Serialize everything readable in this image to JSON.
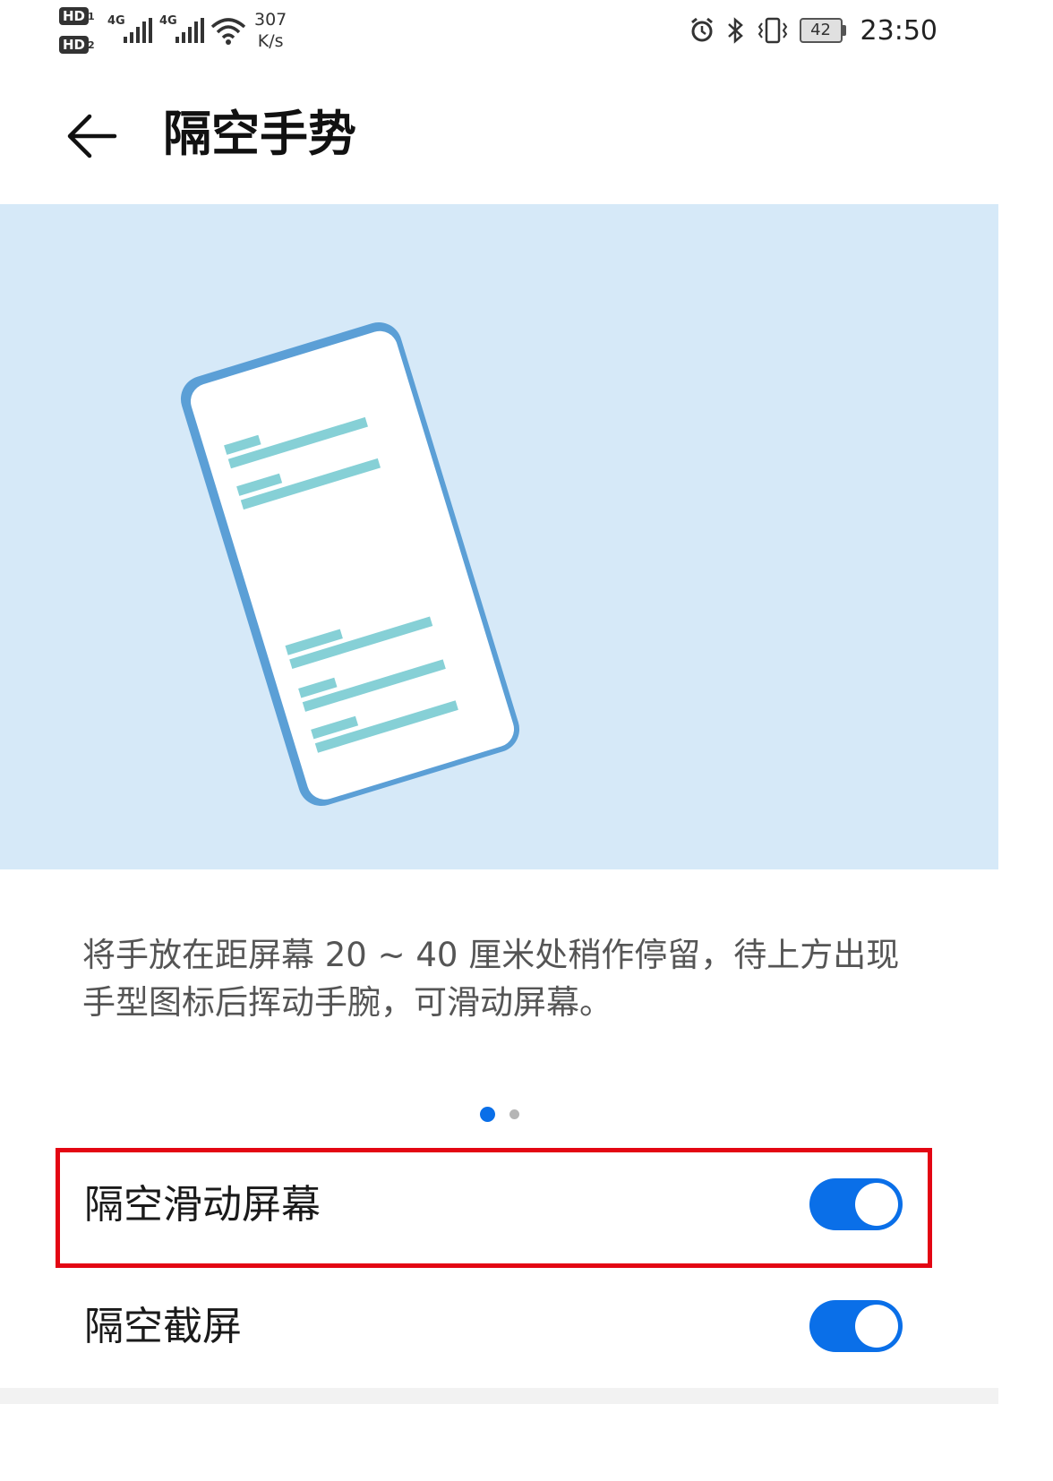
{
  "status_bar": {
    "sim1_label": "HD",
    "sim1_index": "1",
    "sim2_label": "HD",
    "sim2_index": "2",
    "network1": "4G",
    "network2": "4G",
    "net_speed_value": "307",
    "net_speed_unit": "K/s",
    "battery_level": "42",
    "time": "23:50",
    "icons": [
      "alarm-icon",
      "bluetooth-icon",
      "vibrate-icon",
      "battery-icon",
      "wifi-icon",
      "signal-icon"
    ]
  },
  "header": {
    "title": "隔空手势",
    "back_icon": "arrow-left-icon"
  },
  "illustration": {
    "background_color": "#d6e9f8",
    "phone_frame_color": "#5b9fd6",
    "content_line_color": "#86d0d6"
  },
  "description": "将手放在距屏幕 20 ~ 40 厘米处稍作停留，待上方出现手型图标后挥动手腕，可滑动屏幕。",
  "pager": {
    "total": 2,
    "active": 1,
    "active_color": "#0a6fe8"
  },
  "settings": [
    {
      "label": "隔空滑动屏幕",
      "enabled": true,
      "highlighted": true
    },
    {
      "label": "隔空截屏",
      "enabled": true,
      "highlighted": false
    }
  ],
  "colors": {
    "accent": "#0a6fe8",
    "highlight_border": "#e30613"
  }
}
